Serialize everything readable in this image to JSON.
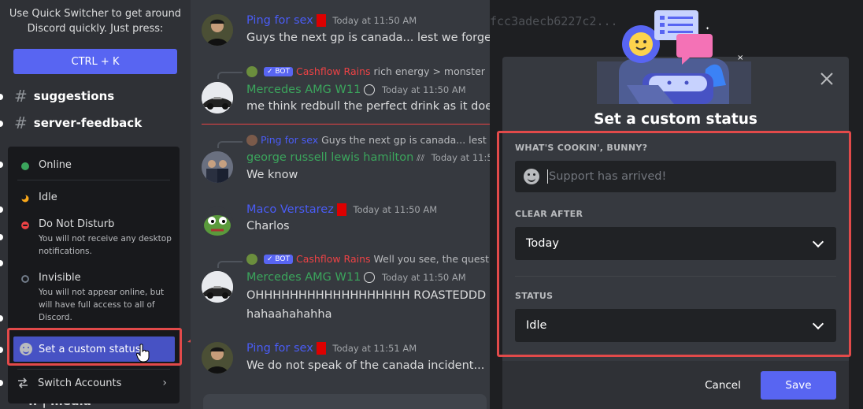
{
  "sidebar": {
    "quick_switcher_text": "Use Quick Switcher to get around Discord quickly. Just press:",
    "quick_switcher_button": "CTRL + K",
    "channels": [
      {
        "name": "suggestions"
      },
      {
        "name": "server-feedback"
      }
    ],
    "bottom_channel": "ff | media"
  },
  "status_menu": {
    "items": [
      {
        "label": "Online",
        "color": "#3ba55c"
      },
      {
        "label": "Idle",
        "color": "#faa81a"
      },
      {
        "label": "Do Not Disturb",
        "color": "#ed4245",
        "description": "You will not receive any desktop notifications."
      },
      {
        "label": "Invisible",
        "color": "#747f8d",
        "description": "You will not appear online, but will have full access to all of Discord."
      }
    ],
    "custom_status_label": "Set a custom status",
    "switch_accounts_label": "Switch Accounts"
  },
  "chat": {
    "messages": [
      {
        "author": "Ping for sex",
        "author_color": "#4a5cf6",
        "time": "Today at 11:50 AM",
        "text": "Guys the next gp is canada... lest we forget."
      },
      {
        "reply_author": "Cashflow Rains",
        "reply_text": "rich energy > monster",
        "bot_tag": "BOT",
        "author": "Mercedes AMG W11",
        "author_color": "#3ba55c",
        "time": "Today at 11:50 AM",
        "text": "me think redbull the perfect drink as it doesnt h"
      },
      {
        "reply_author": "Ping for sex",
        "reply_text": "Guys the next gp is canada... lest w",
        "author": "george russell lewis hamilton",
        "author_color": "#3ba55c",
        "time": "Today at 11:50 AM",
        "text": "We know"
      },
      {
        "author": "Maco Verstarez",
        "author_color": "#4a5cf6",
        "time": "Today at 11:50 AM",
        "text": "Charlos"
      },
      {
        "reply_author": "Cashflow Rains",
        "reply_text": "Well you see, the question",
        "bot_tag": "BOT",
        "author": "Mercedes AMG W11",
        "author_color": "#3ba55c",
        "time": "Today at 11:50 AM",
        "text": "OHHHHHHHHHHHHHHHHHH ROASTEDDD",
        "text2": "hahaahahahha"
      },
      {
        "author": "Ping for sex",
        "author_color": "#4a5cf6",
        "time": "Today at 11:51 AM",
        "text": "We do not speak of the canada incident..."
      }
    ]
  },
  "background_hash": "fcc3adecb6227c2...",
  "modal": {
    "title": "Set a custom status",
    "status_label": "WHAT'S COOKIN', BUNNY?",
    "status_placeholder": "Support has arrived!",
    "clear_after_label": "CLEAR AFTER",
    "clear_after_value": "Today",
    "status_select_label": "STATUS",
    "status_select_value": "Idle",
    "cancel_label": "Cancel",
    "save_label": "Save"
  },
  "colors": {
    "accent": "#5865f2",
    "highlight": "#e24a4a"
  }
}
